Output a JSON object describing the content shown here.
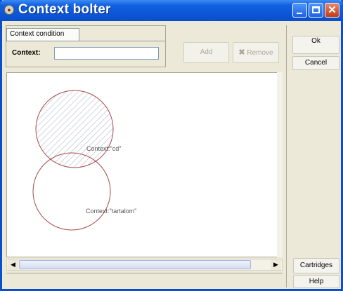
{
  "window": {
    "title": "Context bolter"
  },
  "condition_tab": {
    "label": "Context condition"
  },
  "context_field": {
    "label": "Context:",
    "value": ""
  },
  "buttons": {
    "add": "Add",
    "remove": "Remove",
    "ok": "Ok",
    "cancel": "Cancel",
    "cartridges": "Cartridges",
    "help": "Help"
  },
  "diagram": {
    "nodes": [
      {
        "label": "Context:\"cd\"",
        "hatched": true
      },
      {
        "label": "Context:\"tartalom\"",
        "hatched": false
      }
    ]
  },
  "colors": {
    "title_bar": "#0b55d6",
    "circle_stroke": "#a54a4a",
    "hatch": "#b8bdc8"
  },
  "icons": {
    "remove": "x-icon",
    "app": "app-icon"
  }
}
